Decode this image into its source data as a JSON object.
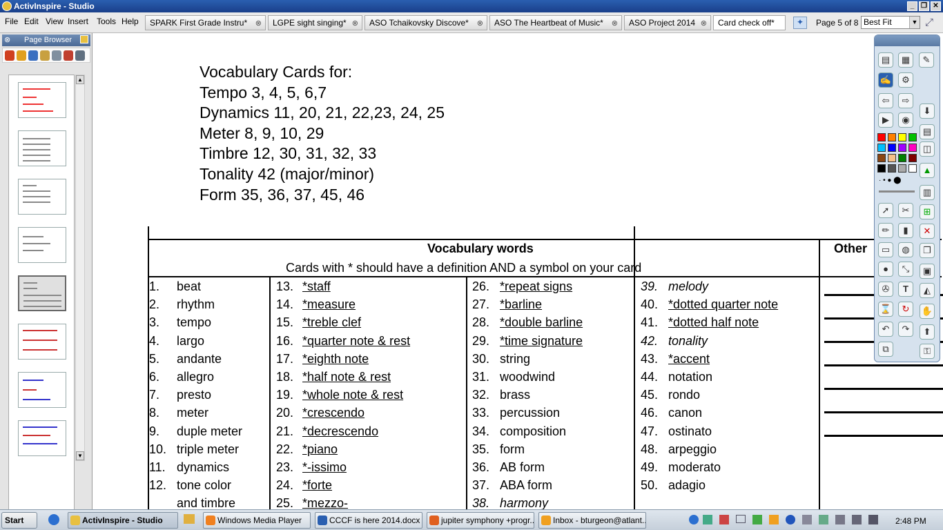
{
  "window": {
    "title": "ActivInspire - Studio"
  },
  "menu": [
    "File",
    "Edit",
    "View",
    "Insert",
    "Tools",
    "Help"
  ],
  "tabs": [
    "SPARK First Grade Instru*",
    "LGPE sight singing*",
    "ASO Tchaikovsky Discove*",
    "ASO The Heartbeat of Music*",
    "ASO Project 2014",
    "Card check off*"
  ],
  "pager": {
    "label": "Page 5 of 8",
    "zoom": "Best Fit"
  },
  "page_browser": {
    "title": "Page Browser",
    "selected_page": 5,
    "page_count": 8
  },
  "slide": {
    "heading": [
      "Vocabulary Cards for:",
      "Tempo 3, 4, 5, 6,7",
      "Dynamics 11, 20, 21, 22,23, 24, 25",
      "Meter 8, 9, 10, 29",
      "Timbre 12, 30, 31, 32, 33",
      "Tonality 42 (major/minor)",
      "Form 35, 36, 37, 45, 46"
    ],
    "table_title": "Vocabulary words",
    "table_subtitle": "Cards with * should have a definition AND a symbol on your card",
    "other_header": "Other",
    "col1": [
      {
        "n": "1.",
        "w": "beat"
      },
      {
        "n": "2.",
        "w": "rhythm"
      },
      {
        "n": "3.",
        "w": "tempo"
      },
      {
        "n": "4.",
        "w": "largo"
      },
      {
        "n": "5.",
        "w": "andante"
      },
      {
        "n": "6.",
        "w": "allegro"
      },
      {
        "n": "7.",
        "w": "presto"
      },
      {
        "n": "8.",
        "w": "meter"
      },
      {
        "n": "9.",
        "w": "duple meter"
      },
      {
        "n": "10.",
        "w": "triple meter"
      },
      {
        "n": "11.",
        "w": "dynamics"
      },
      {
        "n": "12.",
        "w": "tone color"
      },
      {
        "n": "",
        "w": "and timbre"
      }
    ],
    "col2": [
      {
        "n": "13.",
        "w": "*staff"
      },
      {
        "n": "14.",
        "w": "*measure"
      },
      {
        "n": "15.",
        "w": "*treble clef"
      },
      {
        "n": "16.",
        "w": "*quarter note & rest"
      },
      {
        "n": "17.",
        "w": "*eighth note"
      },
      {
        "n": "18.",
        "w": "*half note & rest"
      },
      {
        "n": "19.",
        "w": "*whole note & rest"
      },
      {
        "n": "20.",
        "w": "*crescendo"
      },
      {
        "n": "21.",
        "w": "*decrescendo"
      },
      {
        "n": "22.",
        "w": "*piano"
      },
      {
        "n": "23.",
        "w": "*-issimo"
      },
      {
        "n": "24.",
        "w": "*forte"
      },
      {
        "n": "25.",
        "w": "*mezzo-"
      }
    ],
    "col3": [
      {
        "n": "26.",
        "w": "*repeat signs"
      },
      {
        "n": "27.",
        "w": "*barline"
      },
      {
        "n": "28.",
        "w": "*double barline"
      },
      {
        "n": "29.",
        "w": "*time signature"
      },
      {
        "n": "30.",
        "w": "string"
      },
      {
        "n": "31.",
        "w": "woodwind"
      },
      {
        "n": "32.",
        "w": "brass"
      },
      {
        "n": "33.",
        "w": "percussion"
      },
      {
        "n": "34.",
        "w": "composition"
      },
      {
        "n": "35.",
        "w": "form"
      },
      {
        "n": "36.",
        "w": "AB form"
      },
      {
        "n": "37.",
        "w": "ABA form"
      },
      {
        "n": "38.",
        "w": "harmony"
      }
    ],
    "col4": [
      {
        "n": "39.",
        "w": "melody"
      },
      {
        "n": "40.",
        "w": "*dotted quarter note"
      },
      {
        "n": "41.",
        "w": "*dotted half note"
      },
      {
        "n": "42.",
        "w": "tonality"
      },
      {
        "n": "43.",
        "w": "*accent"
      },
      {
        "n": "44.",
        "w": "notation"
      },
      {
        "n": "45.",
        "w": "rondo"
      },
      {
        "n": "46.",
        "w": "canon"
      },
      {
        "n": "47.",
        "w": "ostinato"
      },
      {
        "n": "48.",
        "w": "arpeggio"
      },
      {
        "n": "49.",
        "w": "moderato"
      },
      {
        "n": "50.",
        "w": "adagio"
      }
    ]
  },
  "taskbar": {
    "start": "Start",
    "items": [
      "ActivInspire - Studio",
      "Windows Media Player",
      "CCCF is here 2014.docx ...",
      "jupiter symphony +progr...",
      "Inbox - bturgeon@atlant..."
    ],
    "clock": "2:48 PM"
  },
  "colors": {
    "accent": "#1a3f8a",
    "swatches": [
      "#ff0000",
      "#ff8000",
      "#ffff00",
      "#00c000",
      "#00c0ff",
      "#0000ff",
      "#a000ff",
      "#ff00c0",
      "#8b4513",
      "#f5c08a",
      "#008000",
      "#800000",
      "#000000",
      "#555555",
      "#aaaaaa",
      "#ffffff"
    ]
  }
}
